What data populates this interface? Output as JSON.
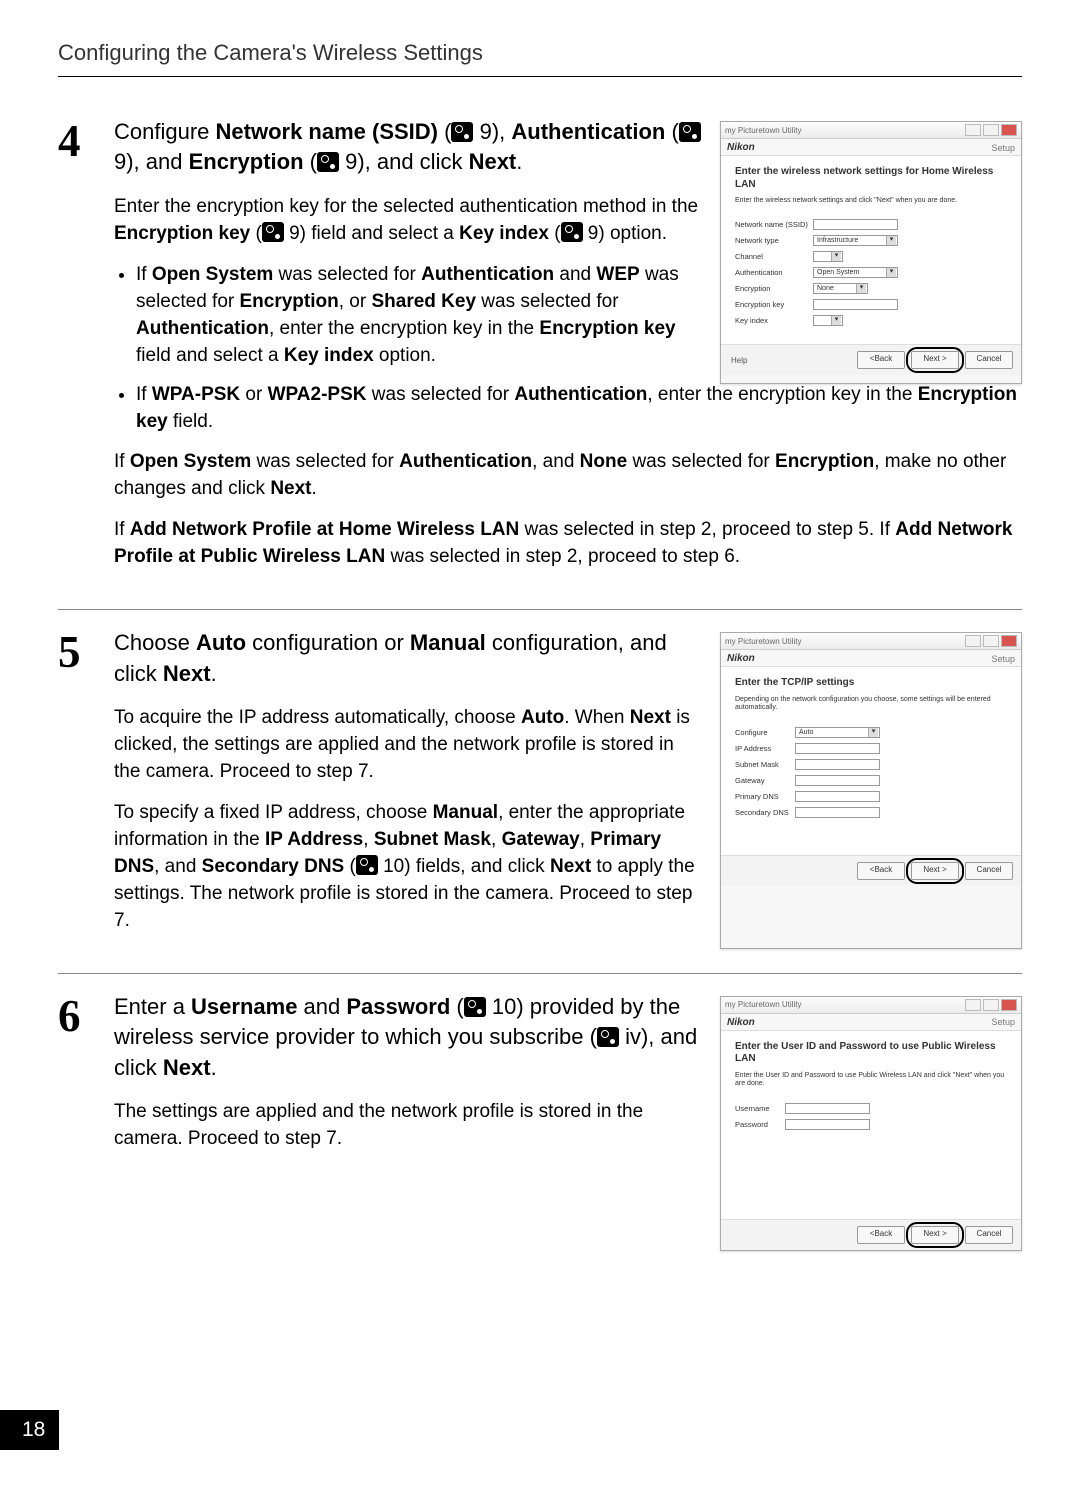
{
  "page": {
    "header": "Configuring the Camera's Wireless Settings",
    "number": "18"
  },
  "steps": {
    "s4": {
      "num": "4",
      "h1_pre": "Configure ",
      "h1_b1": "Network name (SSID)",
      "h1_mid1": " (",
      "h1_ref1": " 9), ",
      "h1_b2": "Authentication",
      "h1_mid2": " (",
      "h1_ref2": " 9), and ",
      "h1_b3": "Encryption",
      "h1_mid3": " (",
      "h1_ref3": " 9), and click ",
      "h1_b4": "Next",
      "h1_end": ".",
      "p1_pre": "Enter the encryption key for the selected authentication method in the ",
      "p1_b1": "Encryption key",
      "p1_mid1": " (",
      "p1_ref1": " 9) field and select a ",
      "p1_b2": "Key index",
      "p1_mid2": " (",
      "p1_ref2": " 9) option.",
      "li1_a": "If ",
      "li1_b1": "Open System",
      "li1_c": " was selected for ",
      "li1_b2": "Authentication",
      "li1_d": " and ",
      "li1_b3": "WEP",
      "li1_e": " was selected for ",
      "li1_b4": "Encryption",
      "li1_f": ", or ",
      "li1_b5": "Shared Key",
      "li1_g": " was selected for ",
      "li1_b6": "Authentication",
      "li1_h": ", enter the encryption key in the ",
      "li1_b7": "Encryption key",
      "li1_i": " field and select a ",
      "li1_b8": "Key index",
      "li1_j": " option.",
      "li2_a": "If ",
      "li2_b1": "WPA-PSK",
      "li2_b": " or ",
      "li2_b2": "WPA2-PSK",
      "li2_c": " was selected for ",
      "li2_b3": "Authentication",
      "li2_d": ", enter the encryption key in the ",
      "li2_b4": "Encryption key",
      "li2_e": " field.",
      "p2_a": "If ",
      "p2_b1": "Open System",
      "p2_b": " was selected for ",
      "p2_b2": "Authentication",
      "p2_c": ", and ",
      "p2_b3": "None",
      "p2_d": " was selected for ",
      "p2_b4": "Encryption",
      "p2_e": ", make no other changes and click ",
      "p2_b5": "Next",
      "p2_f": ".",
      "p3_a": "If ",
      "p3_b1": "Add Network Profile at Home Wireless LAN",
      "p3_b": " was selected in step 2, proceed to step 5. If ",
      "p3_b2": "Add Network Profile at Public Wireless LAN",
      "p3_c": " was selected in step 2, proceed to step 6."
    },
    "s5": {
      "num": "5",
      "h1_a": "Choose ",
      "h1_b1": "Auto",
      "h1_b": " configuration or ",
      "h1_b2": "Manual",
      "h1_c": " configuration, and click ",
      "h1_b3": "Next",
      "h1_d": ".",
      "p1_a": "To acquire the IP address automatically, choose ",
      "p1_b1": "Auto",
      "p1_b": ". When ",
      "p1_b2": "Next",
      "p1_c": " is clicked, the settings are applied and the network profile is stored in the camera. Proceed to step 7.",
      "p2_a": "To specify a fixed IP address, choose ",
      "p2_b1": "Manual",
      "p2_b": ", enter the appropriate information in the ",
      "p2_b2": "IP Address",
      "p2_c": ", ",
      "p2_b3": "Subnet Mask",
      "p2_d": ", ",
      "p2_b4": "Gateway",
      "p2_e": ", ",
      "p2_b5": "Primary DNS",
      "p2_f": ", and ",
      "p2_b6": "Secondary DNS",
      "p2_g": " (",
      "p2_ref": " 10) fields, and click ",
      "p2_b7": "Next",
      "p2_h": " to apply the settings. The network profile is stored in the camera. Proceed to step 7."
    },
    "s6": {
      "num": "6",
      "h1_a": "Enter a ",
      "h1_b1": "Username",
      "h1_b": " and ",
      "h1_b2": "Password",
      "h1_c": " (",
      "h1_ref1": " 10) provided by the wireless service provider to which you subscribe (",
      "h1_ref2": " iv), and click ",
      "h1_b3": "Next",
      "h1_d": ".",
      "p1": "The settings are applied and the network profile is stored in the camera. Proceed to step 7."
    }
  },
  "dlg": {
    "appTitle": "my Picturetown Utility",
    "brand": "Nikon",
    "setup": "Setup",
    "help": "Help",
    "back": "<Back",
    "next": "Next >",
    "cancel": "Cancel",
    "d4": {
      "title": "Enter the wireless network settings for Home Wireless LAN",
      "note": "Enter the wireless network settings and click \"Next\" when you are done.",
      "l_ssid": "Network name (SSID)",
      "l_type": "Network type",
      "v_type": "Infrastructure",
      "l_chan": "Channel",
      "l_auth": "Authentication",
      "v_auth": "Open System",
      "l_enc": "Encryption",
      "v_enc": "None",
      "l_key": "Encryption key",
      "l_idx": "Key index"
    },
    "d5": {
      "title": "Enter the TCP/IP settings",
      "note": "Depending on the network configuration you choose, some settings will be entered automatically.",
      "l_cfg": "Configure",
      "v_cfg": "Auto",
      "l_ip": "IP Address",
      "l_mask": "Subnet Mask",
      "l_gw": "Gateway",
      "l_pdns": "Primary DNS",
      "l_sdns": "Secondary DNS"
    },
    "d6": {
      "title": "Enter the User ID and Password to use Public Wireless LAN",
      "note": "Enter the User ID and Password to use Public Wireless LAN and click \"Next\" when you are done.",
      "l_user": "Username",
      "l_pass": "Password"
    }
  }
}
